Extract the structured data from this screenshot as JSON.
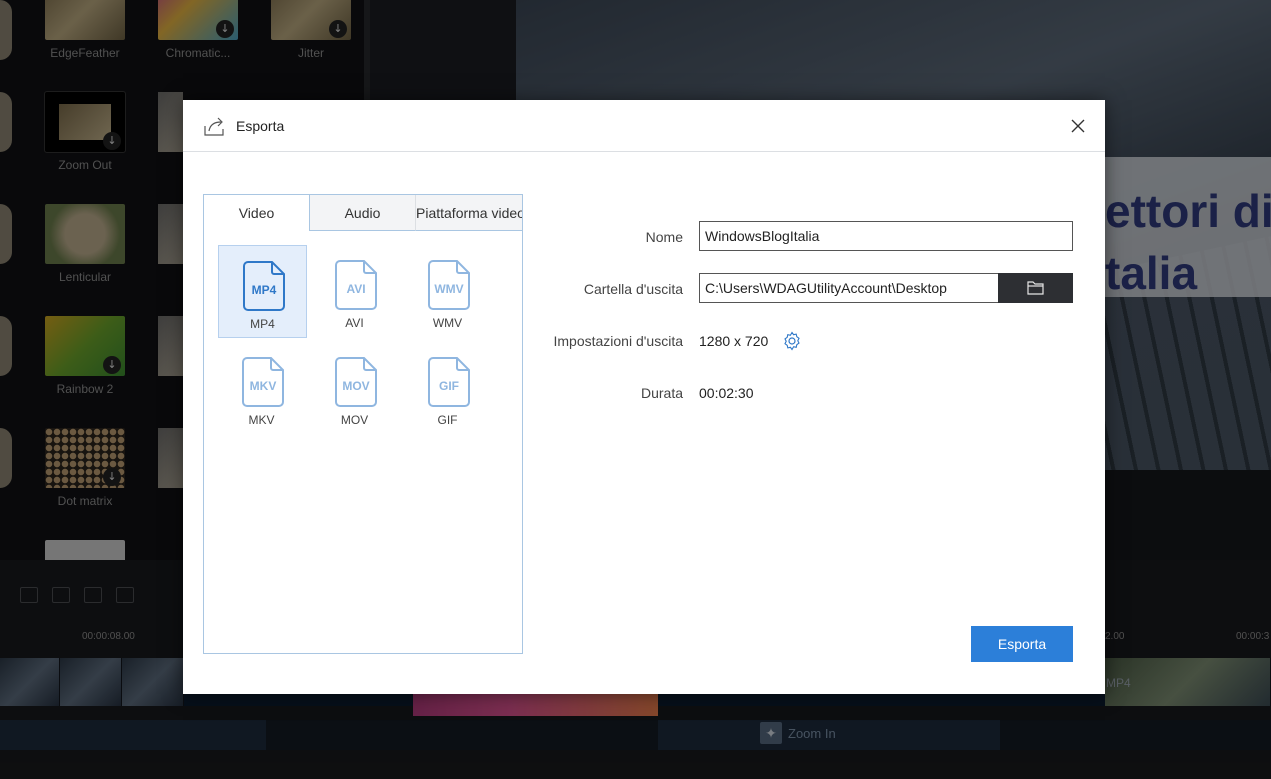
{
  "background": {
    "effects": [
      {
        "name": "EdgeFeather"
      },
      {
        "name": "Chromatic..."
      },
      {
        "name": "Jitter"
      },
      {
        "name": "Zoom Out"
      },
      {
        "name": "Lenticular"
      },
      {
        "name": "Rainbow 2"
      },
      {
        "name": "Dot matrix"
      }
    ],
    "preview_text_line1": "ettori di",
    "preview_text_line2": "talia",
    "timeline": {
      "ticks": [
        "00:00:08.00",
        "2.00",
        "00:00:3"
      ],
      "clip_label": "MP4",
      "zoom_in_label": "Zoom In"
    }
  },
  "dialog": {
    "title": "Esporta",
    "tabs": [
      "Video",
      "Audio",
      "Piattaforma video"
    ],
    "active_tab": "Video",
    "formats": [
      {
        "label": "MP4",
        "icon": "MP4",
        "selected": true
      },
      {
        "label": "AVI",
        "icon": "AVI",
        "selected": false
      },
      {
        "label": "WMV",
        "icon": "WMV",
        "selected": false
      },
      {
        "label": "MKV",
        "icon": "MKV",
        "selected": false
      },
      {
        "label": "MOV",
        "icon": "MOV",
        "selected": false
      },
      {
        "label": "GIF",
        "icon": "GIF",
        "selected": false
      }
    ],
    "fields": {
      "name_label": "Nome",
      "name_value": "WindowsBlogItalia",
      "folder_label": "Cartella d'uscita",
      "folder_value": "C:\\Users\\WDAGUtilityAccount\\Desktop",
      "settings_label": "Impostazioni d'uscita",
      "settings_value": "1280 x 720",
      "duration_label": "Durata",
      "duration_value": "00:02:30"
    },
    "export_button": "Esporta",
    "colors": {
      "accent": "#2c7fd9",
      "selected_bg": "#e4eefb",
      "icon_selected": "#2f78c8",
      "icon_unselected": "#8fb6e0"
    }
  }
}
